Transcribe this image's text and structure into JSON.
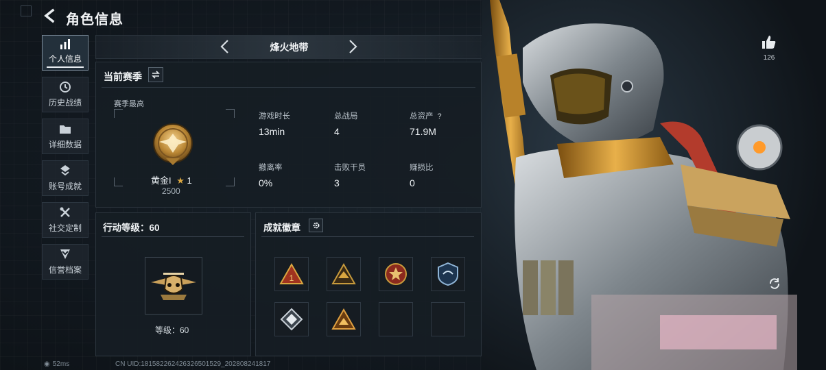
{
  "header": {
    "title": "角色信息"
  },
  "sidebar": {
    "items": [
      {
        "label": "个人信息",
        "icon": "bar-chart-icon",
        "active": true
      },
      {
        "label": "历史战绩",
        "icon": "history-clock-icon"
      },
      {
        "label": "详细数据",
        "icon": "folder-icon"
      },
      {
        "label": "账号成就",
        "icon": "achievement-icon"
      },
      {
        "label": "社交定制",
        "icon": "tools-icon"
      },
      {
        "label": "信誉档案",
        "icon": "shield-chevron-icon"
      }
    ]
  },
  "mode_selector": {
    "name": "烽火地带"
  },
  "season": {
    "title": "当前赛季",
    "best_label": "赛季最高",
    "rank_name": "黄金I",
    "rank_stars": "1",
    "rank_score": "2500",
    "stats": [
      {
        "label": "游戏时长",
        "value": "13min"
      },
      {
        "label": "总战局",
        "value": "4"
      },
      {
        "label": "总资产",
        "value": "71.9M",
        "help": "?"
      },
      {
        "label": "撤离率",
        "value": "0%"
      },
      {
        "label": "击败干员",
        "value": "3"
      },
      {
        "label": "赚损比",
        "value": "0"
      }
    ]
  },
  "level": {
    "title": "行动等级：60",
    "text": "等级：60"
  },
  "badges": {
    "title": "成就徽章",
    "slots": [
      {
        "icon": "triangle-badge-icon"
      },
      {
        "icon": "eagle-triangle-badge-icon"
      },
      {
        "icon": "red-star-medal-icon"
      },
      {
        "icon": "blue-shield-badge-icon"
      },
      {
        "icon": "diamond-badge-icon"
      },
      {
        "icon": "orange-triangle-badge-icon"
      },
      {
        "icon": "empty-slot"
      },
      {
        "icon": "empty-slot"
      }
    ]
  },
  "likes": {
    "count": "126"
  },
  "status_bar": {
    "ping": "52ms",
    "uid": "CN UID:18158226242632650152​9_202808241817"
  },
  "colors": {
    "accent_gold": "#c79a3c",
    "panel": "#161d24",
    "border": "#2b343d"
  }
}
